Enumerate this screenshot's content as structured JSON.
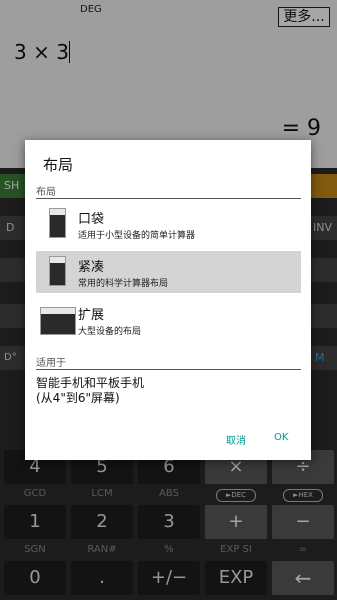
{
  "display": {
    "mode": "DEG",
    "more_label": "更多...",
    "expression": "3 × 3",
    "result": "= 9"
  },
  "keyboard": {
    "row_labels": [
      "GCD",
      "LCM",
      "ABS",
      "►DEC",
      "►HEX"
    ],
    "row_labels2": [
      "SGN",
      "RAN#",
      "%",
      "EXP SI",
      "="
    ],
    "keys_row1": [
      "4",
      "5",
      "6",
      "×",
      "÷"
    ],
    "keys_row2": [
      "1",
      "2",
      "3",
      "+",
      "−"
    ],
    "keys_row3": [
      "0",
      ".",
      "+/−",
      "EXP",
      "←"
    ],
    "peek": {
      "left1": "SH",
      "left2": "D",
      "left3": "D°",
      "right1": "INV",
      "right2": "M"
    }
  },
  "dialog": {
    "title": "布局",
    "section_layout": "布局",
    "options": [
      {
        "label": "口袋",
        "desc": "适用于小型设备的简单计算器"
      },
      {
        "label": "紧凑",
        "desc": "常用的科学计算器布局"
      },
      {
        "label": "扩展",
        "desc": "大型设备的布局"
      }
    ],
    "section_apply": "适用于",
    "apply_line1": "智能手机和平板手机",
    "apply_line2": "(从4\"到6\"屏幕)",
    "cancel": "取消",
    "ok": "OK"
  }
}
